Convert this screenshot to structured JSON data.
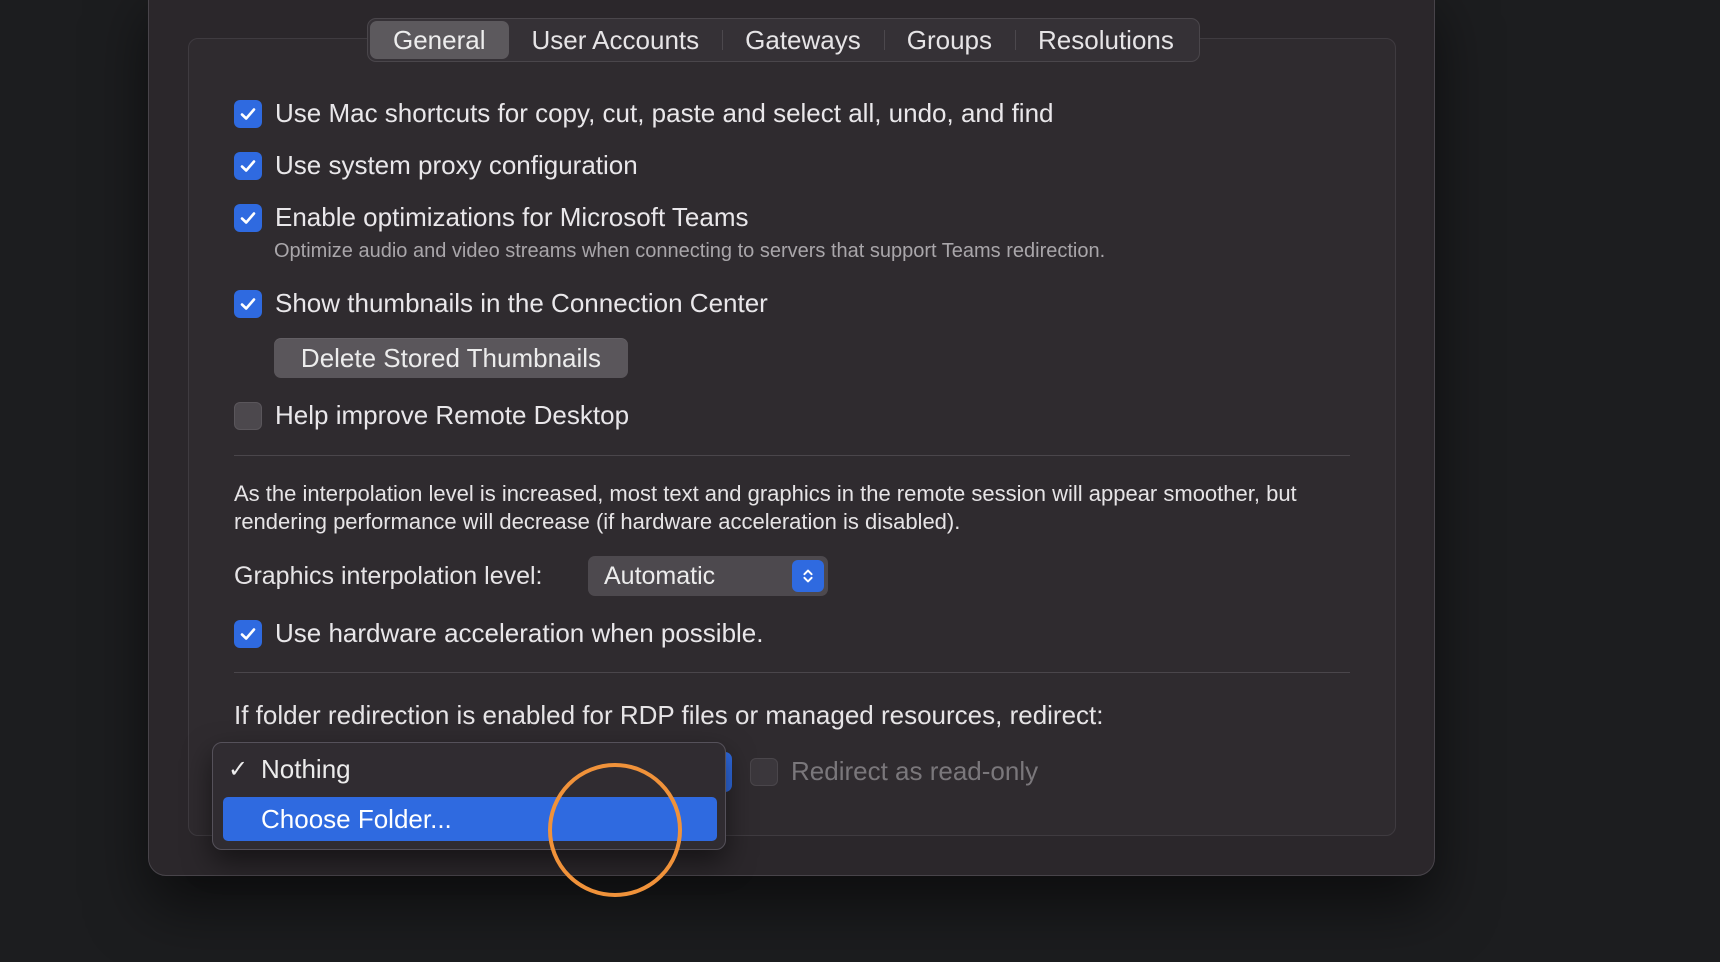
{
  "tabs": [
    {
      "label": "General",
      "active": true
    },
    {
      "label": "User Accounts",
      "active": false
    },
    {
      "label": "Gateways",
      "active": false
    },
    {
      "label": "Groups",
      "active": false
    },
    {
      "label": "Resolutions",
      "active": false
    }
  ],
  "general": {
    "mac_shortcuts": {
      "label": "Use Mac shortcuts for copy, cut, paste and select all, undo, and find",
      "checked": true
    },
    "system_proxy": {
      "label": "Use system proxy configuration",
      "checked": true
    },
    "teams": {
      "label": "Enable optimizations for Microsoft Teams",
      "checked": true,
      "description": "Optimize audio and video streams when connecting to servers that support Teams redirection."
    },
    "thumbnails": {
      "label": "Show thumbnails in the Connection Center",
      "checked": true
    },
    "delete_thumbnails_label": "Delete Stored Thumbnails",
    "help_improve": {
      "label": "Help improve Remote Desktop",
      "checked": false
    }
  },
  "graphics": {
    "description": "As the interpolation level is increased, most text and graphics in the remote session will appear smoother, but rendering performance will decrease (if hardware acceleration is disabled).",
    "interpolation_label": "Graphics interpolation level:",
    "interpolation_value": "Automatic",
    "hardware_acceleration": {
      "label": "Use hardware acceleration when possible.",
      "checked": true
    }
  },
  "folder_redirection": {
    "description": "If folder redirection is enabled for RDP files or managed resources, redirect:",
    "read_only": {
      "label": "Redirect as read-only",
      "checked": false
    },
    "menu": {
      "items": [
        {
          "label": "Nothing",
          "checkmark": "✓",
          "selected": true,
          "highlighted": false
        },
        {
          "label": "Choose Folder...",
          "checkmark": "",
          "selected": false,
          "highlighted": true
        }
      ]
    }
  },
  "colors": {
    "accent": "#2f6ae0",
    "cursor_ring": "#f0923a",
    "background": "#2b272b"
  },
  "icons": {
    "checkbox_checked": "checkmark-icon",
    "select_stepper": "chevron-up-down-icon"
  }
}
